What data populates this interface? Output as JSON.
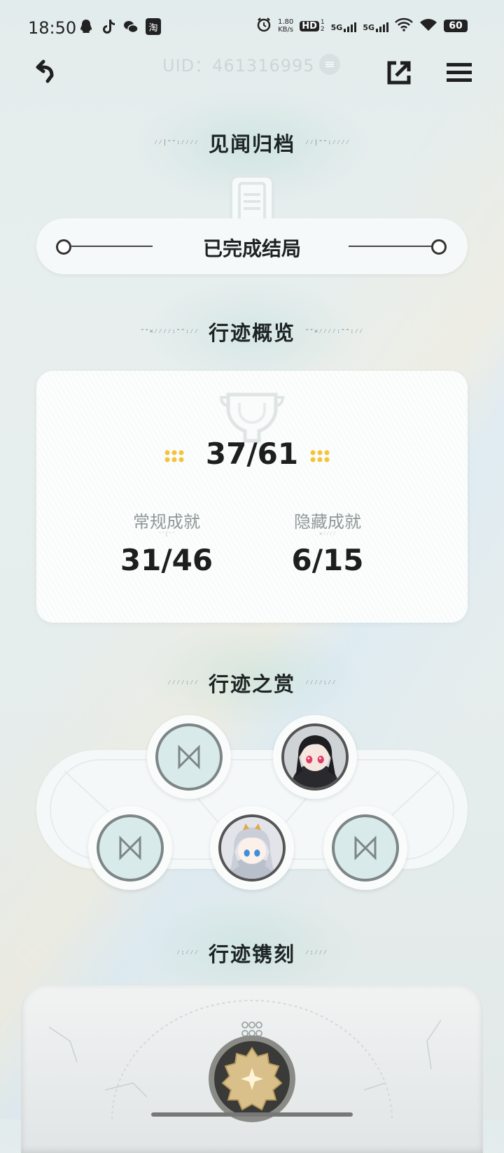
{
  "status_bar": {
    "time": "18:50",
    "left_icons": [
      "qq-icon",
      "tiktok-icon",
      "wechat-icon",
      "taobao-icon"
    ],
    "taobao_label": "淘",
    "net_speed_value": "1.80",
    "net_speed_unit": "KB/s",
    "hd_label": "HD",
    "hd_sub": "1",
    "hd_sub2": "2",
    "signal1_label": "5G",
    "signal2_label": "5G",
    "battery": "60"
  },
  "nav": {
    "uid_label": "UID：461316995"
  },
  "sections": {
    "archive_title": "见闻归档",
    "overview_title": "行迹概览",
    "rewards_title": "行迹之赏",
    "engraving_title": "行迹镌刻"
  },
  "section_deco": {
    "archive_left": "⁄⁄|⁼⁼:⁄⁄⁄⁄",
    "archive_right": "⁄⁄|⁼⁼:⁄⁄⁄⁄",
    "overview_left": "⁼⁼✕⁄⁄⁄⁄:⁼⁼:⁄⁄",
    "overview_right": "⁼⁼✕⁄⁄⁄⁄:⁼⁼:⁄⁄",
    "rewards_left": "⁄⁄⁄⁄:⁄⁄",
    "rewards_right": "⁄⁄⁄⁄:⁄⁄",
    "engraving_left": "⁄:⁄⁄⁄",
    "engraving_right": "⁄:⁄⁄⁄"
  },
  "ending_pill": {
    "label": "已完成结局"
  },
  "overview": {
    "total": "37/61",
    "regular_label": "常规成就",
    "regular_deco": "⁼⁼|⁼⁼",
    "regular_value": "31/46",
    "hidden_label": "隐藏成就",
    "hidden_deco": "✕⁄⁄⁄⁄",
    "hidden_value": "6/15"
  },
  "rewards": {
    "slots": [
      {
        "state": "locked",
        "icon": "bowtie-icon"
      },
      {
        "state": "unlocked",
        "icon": "avatar-dark-haired-character"
      },
      {
        "state": "locked",
        "icon": "bowtie-icon"
      },
      {
        "state": "unlocked",
        "icon": "avatar-silver-haired-character"
      },
      {
        "state": "locked",
        "icon": "bowtie-icon"
      }
    ]
  },
  "colors": {
    "accent_gold": "#f2c43a",
    "slot_locked_bg": "#d9eaea",
    "title_text": "#1e2424"
  }
}
